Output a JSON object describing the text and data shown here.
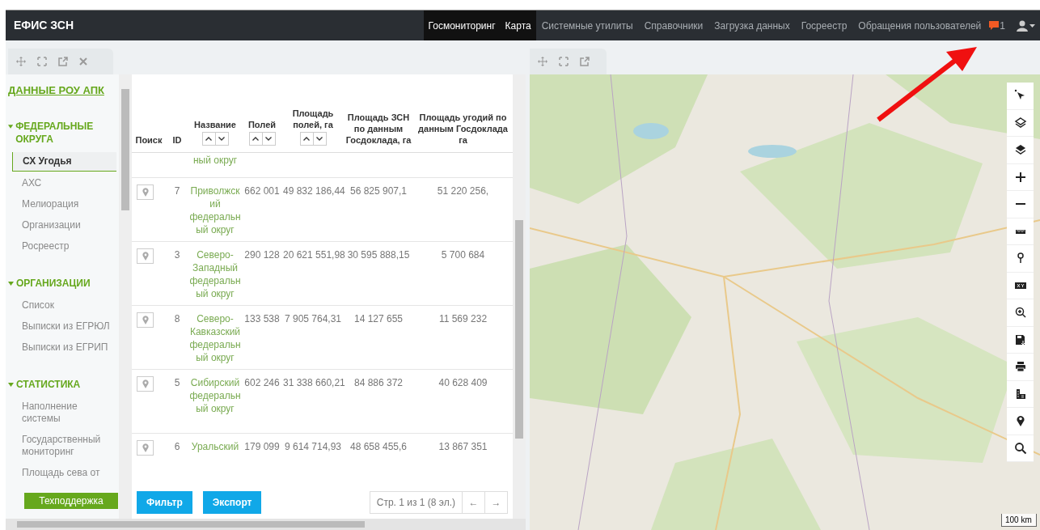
{
  "app": {
    "title": "ЕФИС ЗСН"
  },
  "nav": [
    {
      "label": "Госмониторинг",
      "selected": true
    },
    {
      "label": "Карта",
      "selected": true
    },
    {
      "label": "Системные утилиты",
      "selected": false
    },
    {
      "label": "Справочники",
      "selected": false
    },
    {
      "label": "Загрузка данных",
      "selected": false
    },
    {
      "label": "Госреестр",
      "selected": false
    },
    {
      "label": "Обращения пользователей",
      "selected": false
    }
  ],
  "notifications": {
    "count": "1"
  },
  "sidebar": {
    "title": "ДАННЫЕ РОУ АПК",
    "sections": [
      {
        "title": "ФЕДЕРАЛЬНЫЕ ОКРУГА",
        "expanded": true,
        "items": [
          {
            "label": "СХ Угодья",
            "selected": true
          },
          {
            "label": "АХС",
            "selected": false
          },
          {
            "label": "Мелиорация",
            "selected": false
          },
          {
            "label": "Организации",
            "selected": false
          },
          {
            "label": "Росреестр",
            "selected": false
          }
        ]
      },
      {
        "title": "ОРГАНИЗАЦИИ",
        "expanded": true,
        "items": [
          {
            "label": "Список",
            "selected": false
          },
          {
            "label": "Выписки из ЕГРЮЛ",
            "selected": false
          },
          {
            "label": "Выписки из ЕГРИП",
            "selected": false
          }
        ]
      },
      {
        "title": "СТАТИСТИКА",
        "expanded": true,
        "items": [
          {
            "label": "Наполнение системы",
            "selected": false
          },
          {
            "label": "Государственный мониторинг",
            "selected": false
          },
          {
            "label": "Площадь сева от",
            "selected": false
          }
        ]
      }
    ],
    "support_button": "Техподдержка"
  },
  "table": {
    "columns": [
      {
        "label": "Поиск",
        "sortable": false
      },
      {
        "label": "ID",
        "sortable": false
      },
      {
        "label": "Название",
        "sortable": true
      },
      {
        "label": "Полей",
        "sortable": true
      },
      {
        "label": "Площадь полей, га",
        "sortable": true
      },
      {
        "label": "Площадь ЗСН по данным Госдоклада, га",
        "sortable": false
      },
      {
        "label": "Площадь угодий по данным Госдоклада га",
        "sortable": false
      }
    ],
    "rows": [
      {
        "kind": "partial",
        "name": "ный округ"
      },
      {
        "kind": "full",
        "id": "7",
        "name": "Приволжский федеральный округ",
        "fields": "662 001",
        "area": "49 832 186,44",
        "area_zsn": "56 825 907,1",
        "area_lands": "51 220 256,"
      },
      {
        "kind": "full",
        "id": "3",
        "name": "Северо-Западный федеральный округ",
        "fields": "290 128",
        "area": "20 621 551,98",
        "area_zsn": "30 595 888,15",
        "area_lands": "5 700 684"
      },
      {
        "kind": "full",
        "id": "8",
        "name": "Северо-Кавказский федеральный округ",
        "fields": "133 538",
        "area": "7 905 764,31",
        "area_zsn": "14 127 655",
        "area_lands": "11 569 232"
      },
      {
        "kind": "full",
        "id": "5",
        "name": "Сибирский федеральный округ",
        "fields": "602 246",
        "area": "31 338 660,21",
        "area_zsn": "84 886 372",
        "area_lands": "40 628 409"
      },
      {
        "kind": "full",
        "id": "6",
        "name": "Уральский",
        "fields": "179 099",
        "area": "9 614 714,93",
        "area_zsn": "48 658 455,6",
        "area_lands": "13 867 351"
      }
    ],
    "buttons": [
      "Фильтр",
      "Экспорт"
    ],
    "pager": {
      "label": "Стр. 1 из 1 (8 эл.)",
      "prev": "←",
      "next": "→"
    }
  },
  "map": {
    "scale": "100 km"
  }
}
